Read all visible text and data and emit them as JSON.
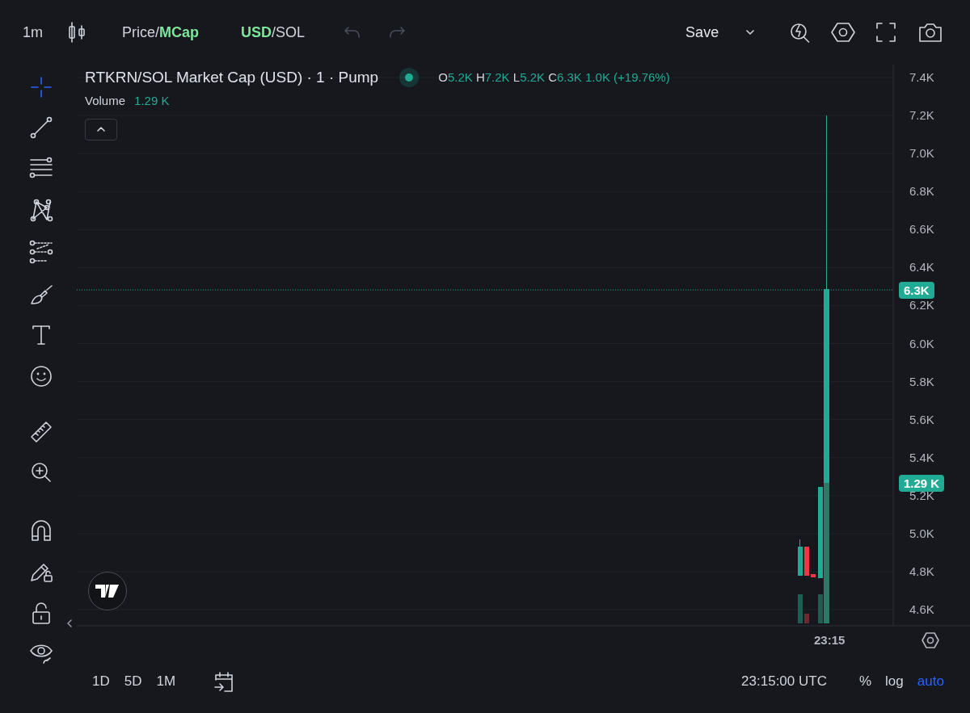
{
  "top_bar": {
    "interval": "1m",
    "price_toggle": [
      {
        "label": "Price",
        "selected": false
      },
      {
        "label": "MCap",
        "selected": true
      }
    ],
    "price_separator": "/",
    "currency_toggle": [
      {
        "label": "USD",
        "selected": true
      },
      {
        "label": "SOL",
        "selected": false
      }
    ],
    "currency_separator": "/",
    "save": "Save"
  },
  "tools": [
    {
      "kind": "crosshair",
      "selected": true
    },
    {
      "kind": "trendline",
      "selected": false
    },
    {
      "kind": "horizontal-lines",
      "selected": false
    },
    {
      "kind": "pattern",
      "selected": false
    },
    {
      "kind": "fib",
      "selected": false
    },
    {
      "kind": "brush",
      "selected": false
    },
    {
      "kind": "text",
      "selected": false
    },
    {
      "kind": "emoji",
      "selected": false
    },
    {
      "kind": "ruler",
      "selected": false
    },
    {
      "kind": "zoom",
      "selected": false
    },
    {
      "kind": "magnet",
      "selected": false
    },
    {
      "kind": "lock-drawing",
      "selected": false
    },
    {
      "kind": "lock",
      "selected": false
    },
    {
      "kind": "eye",
      "selected": false
    }
  ],
  "legend": {
    "title": "RTKRN/SOL Market Cap (USD) · 1 · Pump",
    "ohlc": [
      {
        "label": "O",
        "value": "5.2K"
      },
      {
        "label": "H",
        "value": "7.2K"
      },
      {
        "label": "L",
        "value": "5.2K"
      },
      {
        "label": "C",
        "value": "6.3K"
      }
    ],
    "change": "1.0K (+19.76%)",
    "volume_label": "Volume",
    "volume_value": "1.29 K"
  },
  "price_axis": {
    "ticks": [
      "7.4K",
      "7.2K",
      "7.0K",
      "6.8K",
      "6.6K",
      "6.4K",
      "6.2K",
      "6.0K",
      "5.8K",
      "5.6K",
      "5.4K",
      "5.2K",
      "5.0K",
      "4.8K",
      "4.6K"
    ],
    "current_price": "6.3K",
    "current_volume": "1.29 K"
  },
  "time_axis": {
    "label": "23:15"
  },
  "bottom_bar": {
    "ranges": [
      "1D",
      "5D",
      "1M"
    ],
    "clock": "23:15:00 UTC",
    "options": [
      {
        "label": "%",
        "selected": false
      },
      {
        "label": "log",
        "selected": false
      },
      {
        "label": "auto",
        "selected": true
      }
    ]
  }
}
